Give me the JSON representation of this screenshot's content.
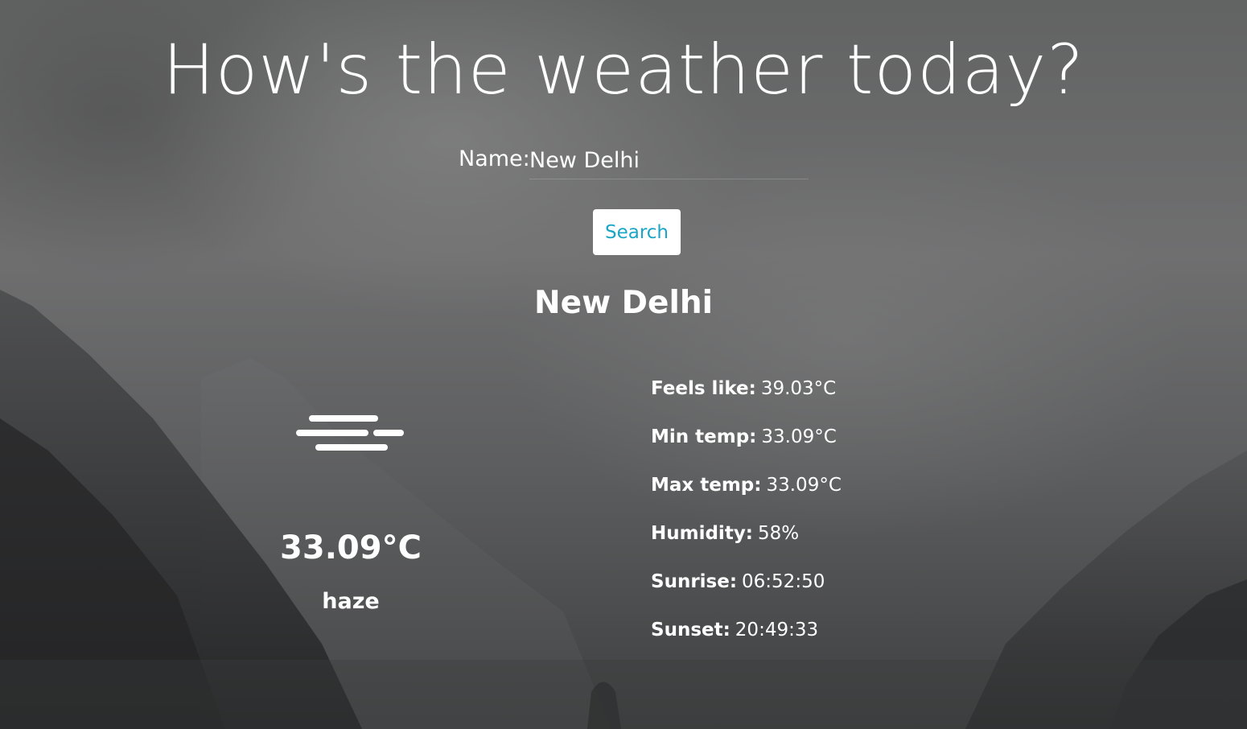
{
  "header": {
    "title": "How's the weather today?"
  },
  "search": {
    "label": "Name:",
    "value": "New Delhi",
    "button_label": "Search"
  },
  "result": {
    "city": "New Delhi",
    "icon": "haze-icon",
    "temperature": "33.09°C",
    "description": "haze",
    "details": [
      {
        "label": "Feels like:",
        "value": "39.03°C"
      },
      {
        "label": "Min temp:",
        "value": "33.09°C"
      },
      {
        "label": "Max temp:",
        "value": "33.09°C"
      },
      {
        "label": "Humidity:",
        "value": "58%"
      },
      {
        "label": "Sunrise:",
        "value": "06:52:50"
      },
      {
        "label": "Sunset:",
        "value": "20:49:33"
      }
    ]
  },
  "colors": {
    "button_text": "#1ba6c8",
    "button_bg": "#ffffff",
    "text": "#ffffff"
  }
}
